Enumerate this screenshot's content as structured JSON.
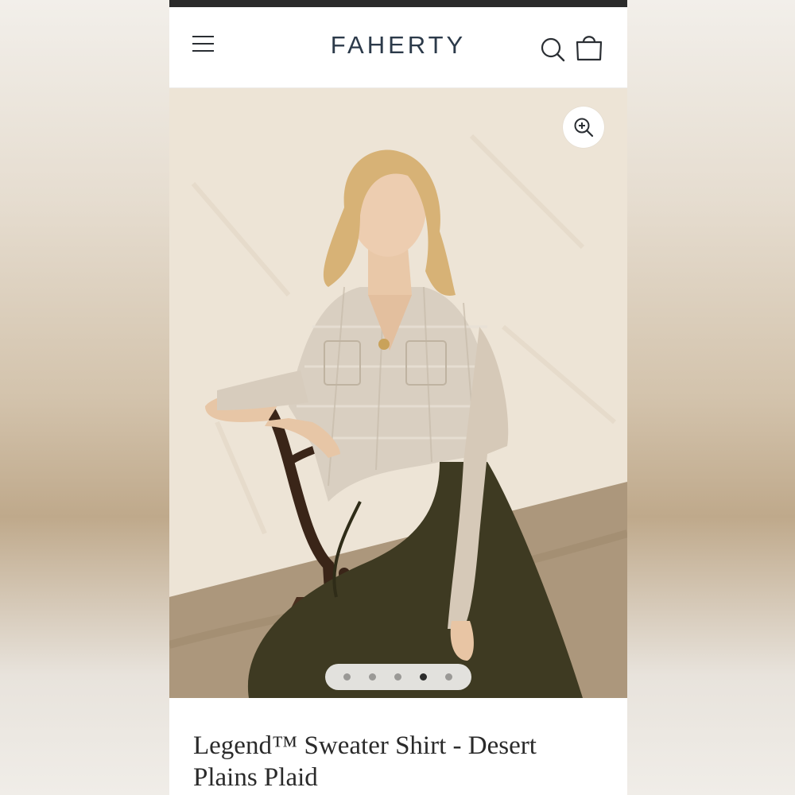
{
  "brand": {
    "logo": "FAHERTY",
    "logo_color": "#2c3a4a"
  },
  "header": {
    "menu_icon": "hamburger-menu-icon",
    "search_icon": "search-icon",
    "bag_icon": "shopping-bag-icon"
  },
  "gallery": {
    "zoom_icon": "zoom-in-icon",
    "image_subject": "model in plaid sweater shirt seated on chair",
    "total_images": 5,
    "active_index": 4
  },
  "product": {
    "title": "Legend™ Sweater Shirt - Desert Plains Plaid"
  }
}
